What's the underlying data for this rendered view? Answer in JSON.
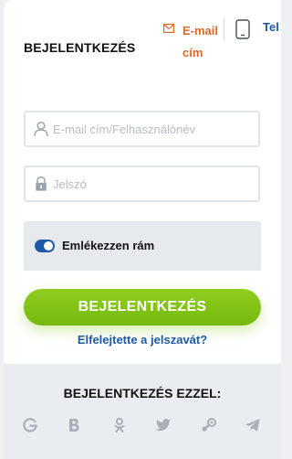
{
  "header": {
    "title": "BEJELENTKEZÉS",
    "tab_email_label": "E-mail cím",
    "tab_phone_label": "Tel",
    "accent_email": "#e0692a",
    "accent_blue": "#1f5aa6"
  },
  "form": {
    "email_placeholder": "E-mail cím/Felhasználónév",
    "email_value": "",
    "password_placeholder": "Jelszó",
    "password_value": ""
  },
  "remember": {
    "label": "Emlékezzen rám",
    "checked": true
  },
  "login_button": {
    "label": "BEJELENTKEZÉS",
    "color": "#7fc31a"
  },
  "forgot_link": {
    "label": "Elfelejtette a jelszavát?"
  },
  "social": {
    "title": "BEJELENTKEZÉS EZZEL:",
    "icons": [
      "google-icon",
      "vk-b-icon",
      "odnoklassniki-icon",
      "twitter-icon",
      "steam-icon",
      "telegram-icon"
    ]
  }
}
